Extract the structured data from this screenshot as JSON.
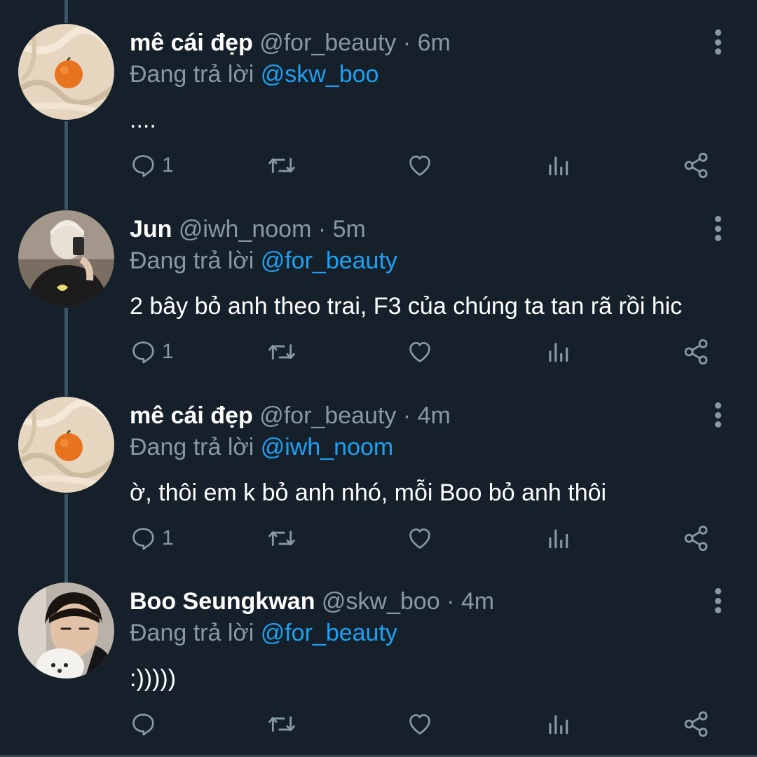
{
  "colors": {
    "background": "#15202b",
    "secondary_text": "#8899a6",
    "mention": "#1da1f2",
    "thread_line": "#3d5466"
  },
  "icons": {
    "reply": "reply-icon",
    "retweet": "retweet-icon",
    "like": "heart-icon",
    "stats": "analytics-icon",
    "share": "share-icon",
    "more": "more-vertical-icon"
  },
  "reply_prefix": "Đang trả lời",
  "tweets": [
    {
      "name": "mê cái đẹp",
      "handle": "@for_beauty",
      "dot": "·",
      "time": "6m",
      "reply_to": "@skw_boo",
      "text": "....",
      "reply_count": "1"
    },
    {
      "name": "Jun",
      "handle": "@iwh_noom",
      "dot": "·",
      "time": "5m",
      "reply_to": "@for_beauty",
      "text": "2 bây bỏ anh theo trai, F3 của chúng ta tan rã rồi hic",
      "reply_count": "1"
    },
    {
      "name": "mê cái đẹp",
      "handle": "@for_beauty",
      "dot": "·",
      "time": "4m",
      "reply_to": "@iwh_noom",
      "text": "ờ, thôi em k bỏ anh nhó, mỗi Boo bỏ anh thôi",
      "reply_count": "1"
    },
    {
      "name": "Boo Seungkwan",
      "handle": "@skw_boo",
      "dot": "·",
      "time": "4m",
      "reply_to": "@for_beauty",
      "text": ":)))))",
      "reply_count": ""
    }
  ]
}
